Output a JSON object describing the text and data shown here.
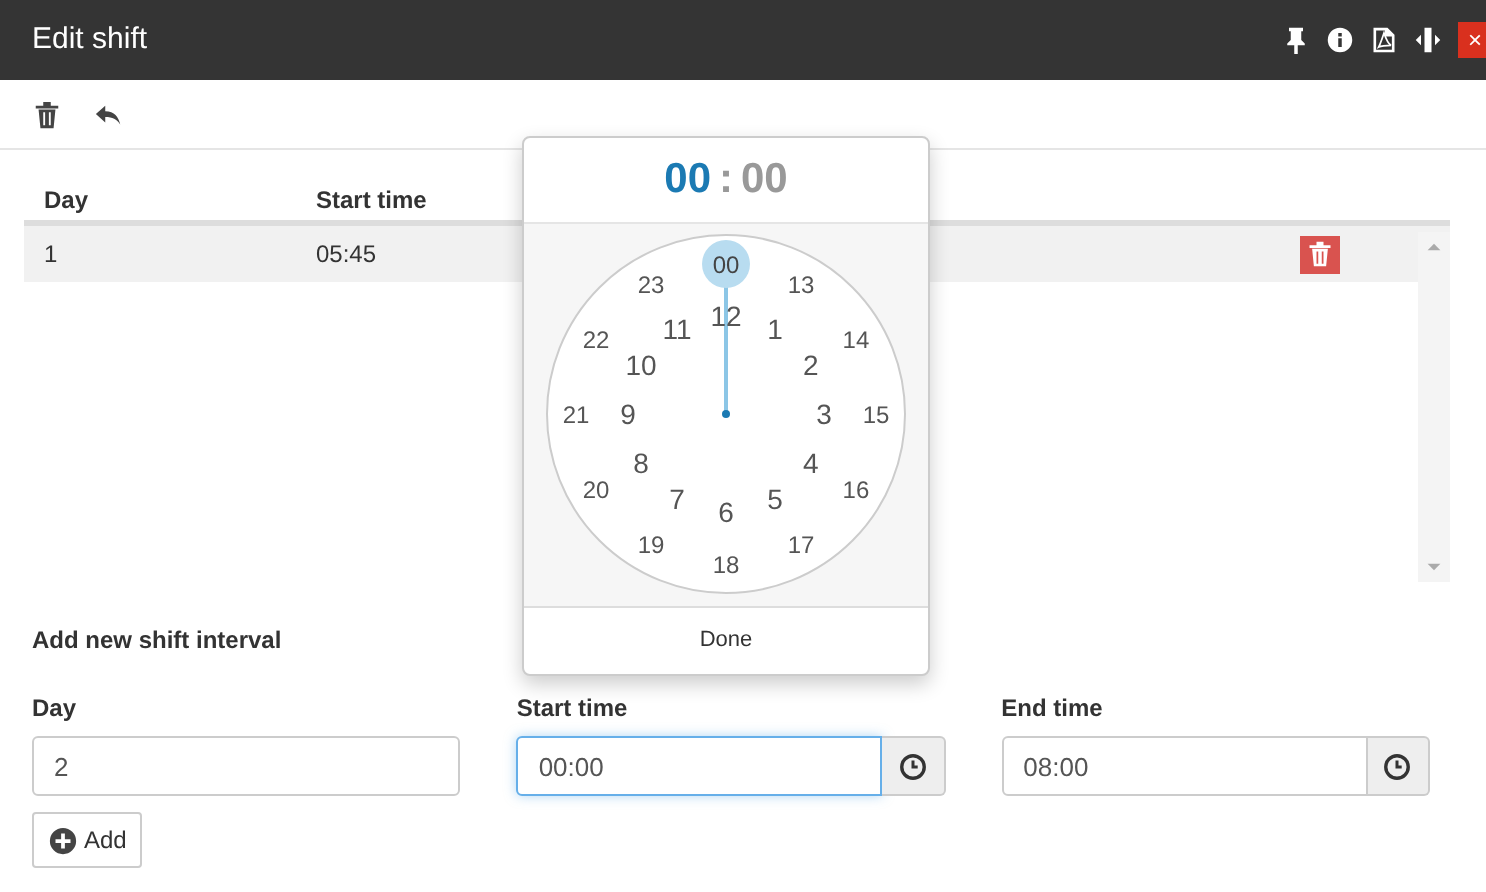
{
  "window": {
    "title": "Edit shift",
    "close_label": "×"
  },
  "table": {
    "columns": [
      "Day",
      "Start time"
    ],
    "rows": [
      {
        "cells": [
          "1",
          "05:45"
        ],
        "selected": true
      }
    ]
  },
  "form": {
    "heading": "Add new shift interval",
    "fields": [
      {
        "label": "Day",
        "value": "2",
        "kind": "text",
        "focused": false
      },
      {
        "label": "Start time",
        "value": "00:00",
        "kind": "time",
        "focused": true
      },
      {
        "label": "End time",
        "value": "08:00",
        "kind": "time",
        "focused": false
      }
    ],
    "add_button": "Add"
  },
  "clock": {
    "display": [
      {
        "text": "00",
        "selected": true
      },
      {
        "text": "00",
        "selected": false
      }
    ],
    "separator": ":",
    "outer_right": [
      {
        "label": "00",
        "selected": true
      },
      {
        "label": "13",
        "selected": false
      },
      {
        "label": "14",
        "selected": false
      },
      {
        "label": "15",
        "selected": false
      },
      {
        "label": "16",
        "selected": false
      },
      {
        "label": "17",
        "selected": false
      },
      {
        "label": "18",
        "selected": false
      }
    ],
    "outer_left": [
      {
        "label": "23",
        "selected": false
      },
      {
        "label": "22",
        "selected": false
      },
      {
        "label": "21",
        "selected": false
      },
      {
        "label": "20",
        "selected": false
      },
      {
        "label": "19",
        "selected": false
      }
    ],
    "inner_right": [
      {
        "label": "12",
        "selected": false
      },
      {
        "label": "1",
        "selected": false
      },
      {
        "label": "2",
        "selected": false
      },
      {
        "label": "3",
        "selected": false
      },
      {
        "label": "4",
        "selected": false
      },
      {
        "label": "5",
        "selected": false
      },
      {
        "label": "6",
        "selected": false
      }
    ],
    "inner_left": [
      {
        "label": "11",
        "selected": false
      },
      {
        "label": "10",
        "selected": false
      },
      {
        "label": "9",
        "selected": false
      },
      {
        "label": "8",
        "selected": false
      },
      {
        "label": "7",
        "selected": false
      }
    ],
    "done": "Done"
  }
}
